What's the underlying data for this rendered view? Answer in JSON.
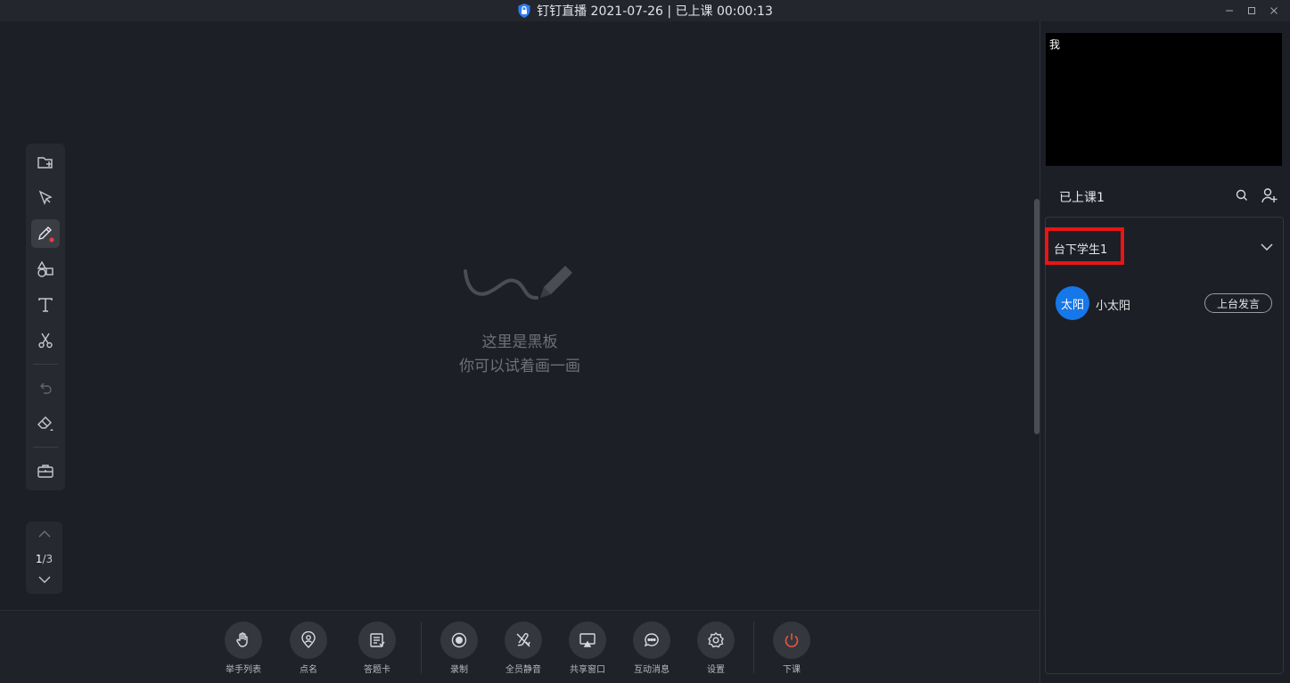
{
  "window": {
    "title": "钉钉直播 2021-07-26 | 已上课 00:00:13",
    "minimize_icon": "minimize-icon",
    "maximize_icon": "maximize-icon",
    "close_icon": "close-icon"
  },
  "toolbar": {
    "tools": [
      {
        "name": "new-page-icon"
      },
      {
        "name": "select-cursor-icon"
      },
      {
        "name": "pen-icon",
        "active": true
      },
      {
        "name": "shapes-icon"
      },
      {
        "name": "text-icon"
      },
      {
        "name": "scissors-icon"
      },
      {
        "name": "undo-icon",
        "disabled": true
      },
      {
        "name": "eraser-icon"
      },
      {
        "name": "toolbox-icon"
      }
    ],
    "accent": "#e84040"
  },
  "pager": {
    "current": "1",
    "separator": "/",
    "total": "3"
  },
  "board": {
    "placeholder_line1": "这里是黑板",
    "placeholder_line2": "你可以试着画一画"
  },
  "bottombar": {
    "buttons": [
      {
        "label": "举手列表",
        "icon": "raise-hand-icon"
      },
      {
        "label": "点名",
        "icon": "roll-call-icon"
      },
      {
        "label": "答题卡",
        "icon": "answer-card-icon"
      },
      {
        "label": "录制",
        "icon": "record-icon"
      },
      {
        "label": "全员静音",
        "icon": "mute-all-icon"
      },
      {
        "label": "共享窗口",
        "icon": "share-window-icon"
      },
      {
        "label": "互动消息",
        "icon": "chat-icon"
      },
      {
        "label": "设置",
        "icon": "settings-icon"
      },
      {
        "label": "下课",
        "icon": "power-icon",
        "color": "#e8553a"
      }
    ]
  },
  "right_panel": {
    "video_label": "我",
    "class_title": "已上课1",
    "group_title": "台下学生1",
    "highlight_color": "#e81515",
    "student": {
      "avatar_text": "太阳",
      "avatar_color": "#1677e8",
      "name": "小太阳",
      "action_label": "上台发言"
    }
  }
}
